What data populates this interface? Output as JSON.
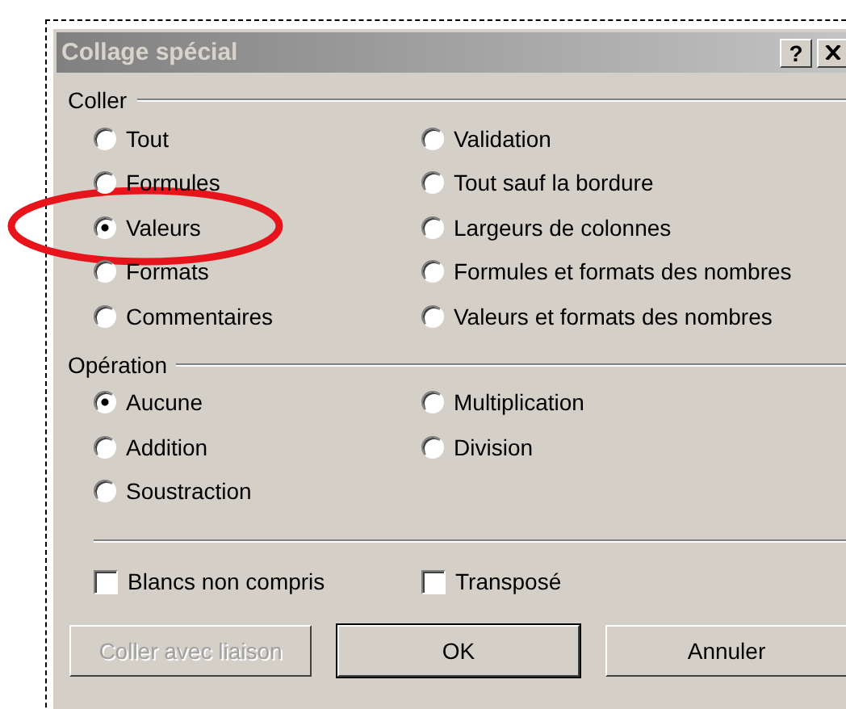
{
  "window": {
    "title": "Collage spécial",
    "help": "?"
  },
  "paste": {
    "label": "Coller",
    "options": [
      {
        "label": "Tout",
        "selected": false
      },
      {
        "label": "Formules",
        "selected": false
      },
      {
        "label": "Valeurs",
        "selected": true
      },
      {
        "label": "Formats",
        "selected": false
      },
      {
        "label": "Commentaires",
        "selected": false
      },
      {
        "label": "Validation",
        "selected": false
      },
      {
        "label": "Tout sauf la bordure",
        "selected": false
      },
      {
        "label": "Largeurs de colonnes",
        "selected": false
      },
      {
        "label": "Formules et formats des nombres",
        "selected": false
      },
      {
        "label": "Valeurs et formats des nombres",
        "selected": false
      }
    ]
  },
  "operation": {
    "label": "Opération",
    "options": [
      {
        "label": "Aucune",
        "selected": true
      },
      {
        "label": "Addition",
        "selected": false
      },
      {
        "label": "Soustraction",
        "selected": false
      },
      {
        "label": "Multiplication",
        "selected": false
      },
      {
        "label": "Division",
        "selected": false
      }
    ]
  },
  "checkboxes": [
    {
      "label": "Blancs non compris",
      "checked": false
    },
    {
      "label": "Transposé",
      "checked": false
    }
  ],
  "buttons": [
    {
      "label": "Coller avec liaison",
      "disabled": true,
      "default": false
    },
    {
      "label": "OK",
      "disabled": false,
      "default": true
    },
    {
      "label": "Annuler",
      "disabled": false,
      "default": false
    }
  ]
}
